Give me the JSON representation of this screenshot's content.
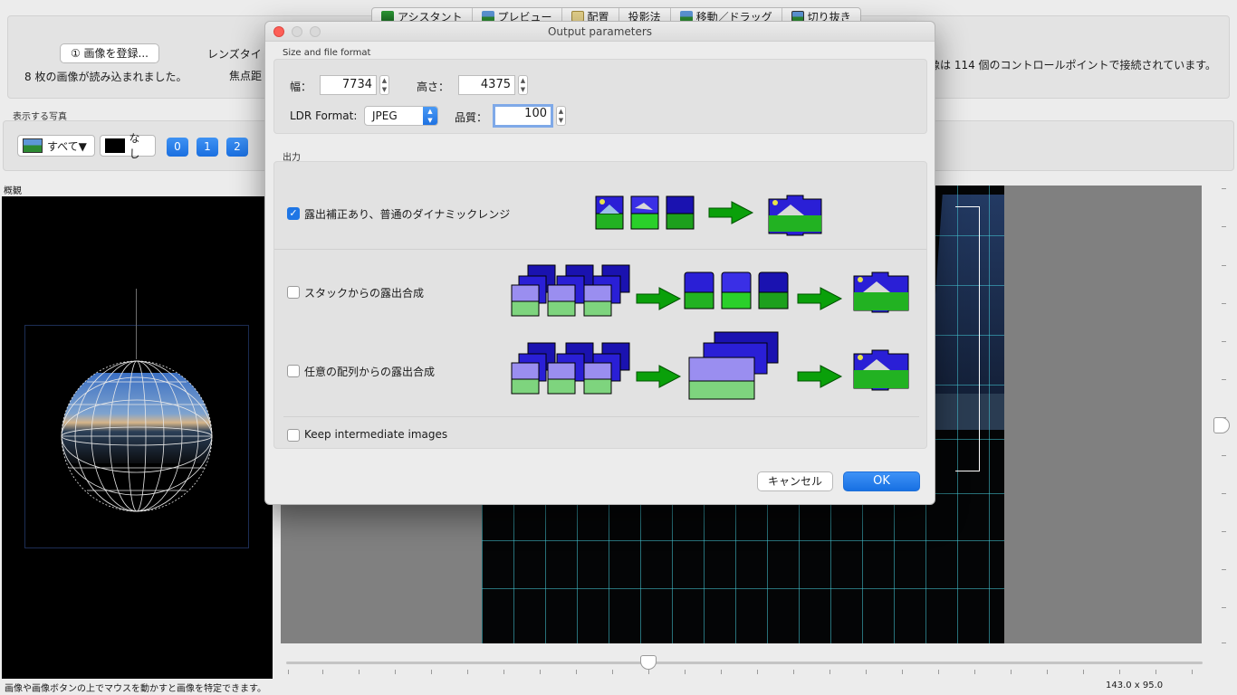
{
  "tabs": [
    {
      "label": "アシスタント",
      "icon": "assistant-icon"
    },
    {
      "label": "プレビュー",
      "icon": "preview-icon"
    },
    {
      "label": "配置",
      "icon": "layout-icon"
    },
    {
      "label": "投影法",
      "icon": ""
    },
    {
      "label": "移動／ドラッグ",
      "icon": "move-drag-icon"
    },
    {
      "label": "切り抜き",
      "icon": "crop-icon"
    }
  ],
  "assistant": {
    "load_button": "① 画像を登録...",
    "loaded_text": "8 枚の画像が読み込まれました。",
    "lens_type_label": "レンズタイ",
    "focal_label": "焦点距",
    "control_points_text": "像は 114 個のコントロールポイントで接続されています。"
  },
  "photos": {
    "label": "表示する写真",
    "all_button": "すべて▼",
    "none_button": "なし",
    "numbers": [
      "0",
      "1",
      "2"
    ]
  },
  "overview_label": "概観",
  "status": {
    "left": "画像や画像ボタンの上でマウスを動かすと画像を特定できます。",
    "right": "143.0 x 95.0"
  },
  "dialog": {
    "title": "Output parameters",
    "size_section": "Size and file format",
    "width_label": "幅：",
    "width_value": "7734",
    "height_label": "高さ：",
    "height_value": "4375",
    "ldr_label": "LDR Format:",
    "ldr_value": "JPEG",
    "quality_label": "品質：",
    "quality_value": "100",
    "output_section": "出力",
    "options": [
      {
        "label": "露出補正あり、普通のダイナミックレンジ",
        "checked": true
      },
      {
        "label": "スタックからの露出合成",
        "checked": false
      },
      {
        "label": "任意の配列からの露出合成",
        "checked": false
      }
    ],
    "keep_label": "Keep intermediate images",
    "keep_checked": false,
    "cancel": "キャンセル",
    "ok": "OK"
  },
  "colors": {
    "accent": "#1f76e5",
    "arrow_green": "#0aa00a",
    "grid_cyan": "#46c8d7"
  }
}
